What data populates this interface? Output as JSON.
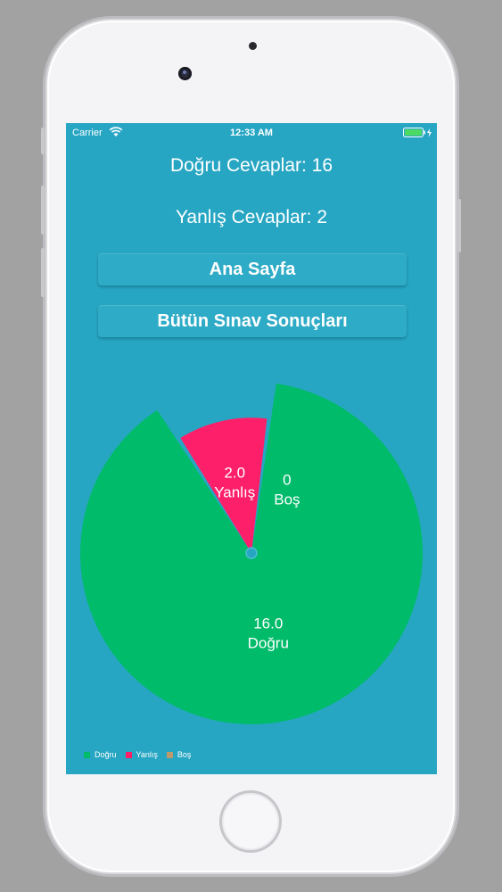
{
  "status_bar": {
    "carrier": "Carrier",
    "time": "12:33 AM"
  },
  "results": {
    "correct_text": "Doğru Cevaplar: 16",
    "wrong_text": "Yanlış Cevaplar: 2"
  },
  "buttons": {
    "home_label": "Ana Sayfa",
    "all_results_label": "Bütün Sınav Sonuçları"
  },
  "chart_data": {
    "type": "pie",
    "slices": [
      {
        "label": "Doğru",
        "value": 16.0,
        "value_label": "16.0",
        "color": "#00bb6a"
      },
      {
        "label": "Yanlış",
        "value": 2.0,
        "value_label": "2.0",
        "color": "#fe1f6a"
      },
      {
        "label": "Boş",
        "value": 0,
        "value_label": "0",
        "color": "#bd9a6b"
      }
    ],
    "legend": [
      "Doğru",
      "Yanlış",
      "Boş"
    ],
    "legend_position": "bottom-left"
  },
  "colors": {
    "screen_background": "#27a6c3",
    "correct": "#00bb6a",
    "wrong": "#fe1f6a",
    "empty": "#bd9a6b"
  }
}
